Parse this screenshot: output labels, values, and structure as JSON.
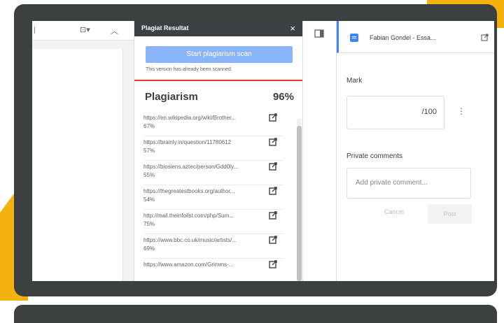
{
  "colors": {
    "accent_yellow": "#f3b20e",
    "device_frame": "#3d4040",
    "scan_button": "#8ab4f8",
    "divider_red": "#e53935",
    "file_blue": "#4285f4"
  },
  "doc_toolbar": {
    "left_icon": "image-icon",
    "dropdown_icon": "chevron-down-icon",
    "collapse_icon": "chevron-up-icon"
  },
  "plagiarism_panel": {
    "title": "Plagiat Resultat",
    "close_label": "×",
    "scan_button": "Start plagiarism scan",
    "scan_note": "This version has already been scanned.",
    "heading": "Plagiarism",
    "overall_percent": "96%",
    "results": [
      {
        "url": "https://en.wikipedia.org/wiki/Brother...",
        "percent": "67%"
      },
      {
        "url": "https://brainly.in/question/11780612",
        "percent": "57%"
      },
      {
        "url": "https://biosiens.aztec/person/Gdd0ly...",
        "percent": "55%"
      },
      {
        "url": "https://thegreatestbooks.org/author...",
        "percent": "54%"
      },
      {
        "url": "http://mail.theinfoilst.com/php/Sum...",
        "percent": "75%"
      },
      {
        "url": "https://www.bbc.co.uk/music/artists/...",
        "percent": "69%"
      },
      {
        "url": "https://www.amazon.com/Grimms-...",
        "percent": ""
      }
    ]
  },
  "right_panel": {
    "file_name": "Fabian Gondel - Essa...",
    "mark_label": "Mark",
    "mark_denominator": "/100",
    "kebab": "⋮",
    "private_comments_label": "Private comments",
    "private_comment_placeholder": "Add private comment...",
    "cancel_label": "Cancel",
    "post_label": "Post"
  }
}
